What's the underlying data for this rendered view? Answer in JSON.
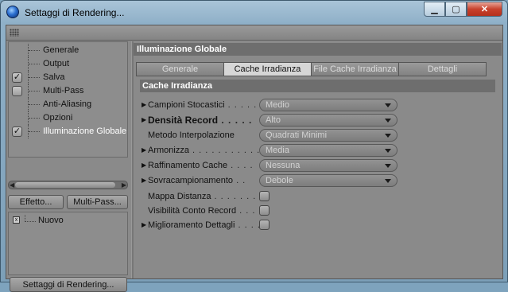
{
  "window": {
    "title": "Settaggi di Rendering...",
    "buttons": {
      "minimize": "▁",
      "maximize": "▢",
      "close": "✕"
    }
  },
  "sidebar": {
    "items": [
      {
        "label": "Generale",
        "check": ""
      },
      {
        "label": "Output",
        "check": ""
      },
      {
        "label": "Salva",
        "check": "✓"
      },
      {
        "label": "Multi-Pass",
        "check": ""
      },
      {
        "label": "Anti-Aliasing",
        "check": ""
      },
      {
        "label": "Opzioni",
        "check": ""
      },
      {
        "label": "Illuminazione Globale",
        "check": "✓"
      }
    ],
    "effect_button": "Effetto...",
    "multipass_button": "Multi-Pass...",
    "list_items": [
      {
        "label": "Nuovo",
        "icon": "x"
      }
    ],
    "render_settings_button": "Settaggi di Rendering..."
  },
  "main": {
    "section_title": "Illuminazione Globale",
    "tabs": [
      {
        "label": "Generale",
        "active": false
      },
      {
        "label": "Cache Irradianza",
        "active": true
      },
      {
        "label": "File Cache Irradianza",
        "active": false
      },
      {
        "label": "Dettagli",
        "active": false
      }
    ],
    "subsection_title": "Cache Irradianza",
    "params": [
      {
        "label": "Campioni Stocastici",
        "dots": " . . . . . .",
        "value": "Medio"
      },
      {
        "label": "Densità Record",
        "dots": " . . . . .",
        "value": "Alto"
      },
      {
        "label": "Metodo Interpolazione",
        "dots": "",
        "value": "Quadrati Minimi"
      },
      {
        "label": "Armonizza",
        "dots": " . . . . . . . . . . . . . .",
        "value": "Media"
      },
      {
        "label": "Raffinamento Cache",
        "dots": " . . . .",
        "value": "Nessuna"
      },
      {
        "label": "Sovracampionamento",
        "dots": " . .",
        "value": "Debole"
      }
    ],
    "checks": [
      {
        "label": "Mappa Distanza",
        "dots": " . . . . . . . . ."
      },
      {
        "label": "Visibilità Conto Record",
        "dots": " . . . ."
      },
      {
        "label": "Miglioramento Dettagli",
        "dots": " . . . ."
      }
    ]
  }
}
